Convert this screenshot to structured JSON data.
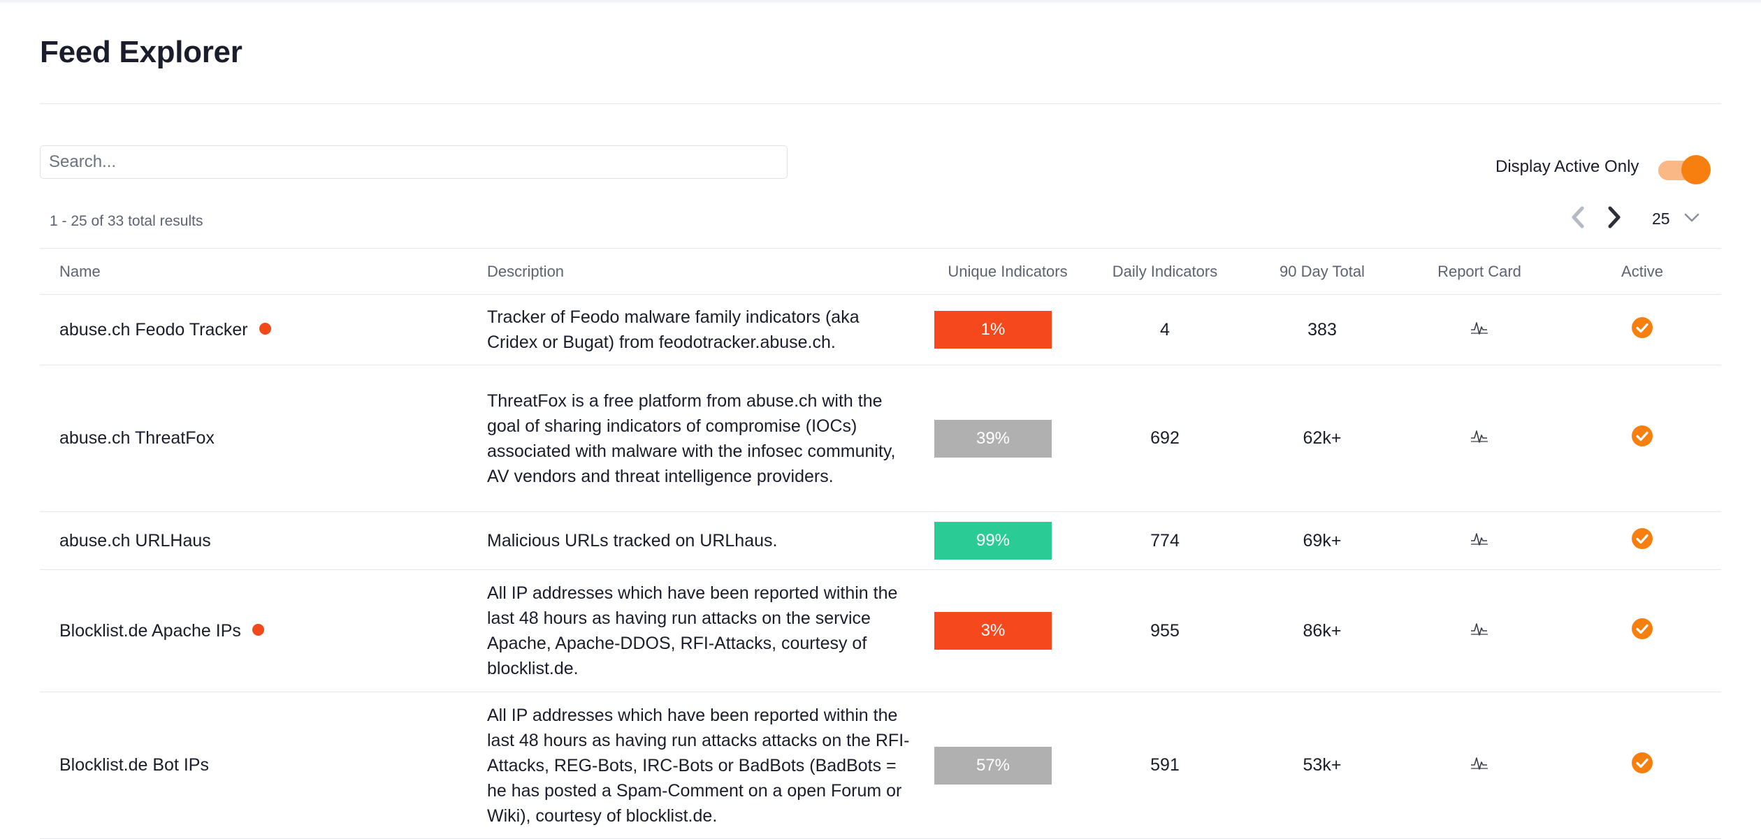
{
  "page": {
    "title": "Feed Explorer"
  },
  "search": {
    "placeholder": "Search...",
    "value": ""
  },
  "filters": {
    "active_only_label": "Display Active Only",
    "active_only": true
  },
  "pagination": {
    "summary": "1 - 25 of 33 total results",
    "per_page": "25"
  },
  "table": {
    "columns": {
      "name": "Name",
      "description": "Description",
      "unique": "Unique Indicators",
      "daily": "Daily Indicators",
      "total": "90 Day Total",
      "report": "Report Card",
      "active": "Active"
    },
    "rows": [
      {
        "name": "abuse.ch Feodo Tracker",
        "alert": true,
        "description": "Tracker of Feodo malware family indicators (aka Cridex or Bugat) from feodotracker.abuse.ch.",
        "unique_pct": "1%",
        "unique_color": "#f5481c",
        "daily": "4",
        "total": "383",
        "active": true
      },
      {
        "name": "abuse.ch ThreatFox",
        "alert": false,
        "description": "ThreatFox is a free platform from abuse.ch with the goal of sharing indicators of compromise (IOCs) associated with malware with the infosec community, AV vendors and threat intelligence providers.",
        "unique_pct": "39%",
        "unique_color": "#b0b0b0",
        "daily": "692",
        "total": "62k+",
        "active": true
      },
      {
        "name": "abuse.ch URLHaus",
        "alert": false,
        "description": "Malicious URLs tracked on URLhaus.",
        "unique_pct": "99%",
        "unique_color": "#2bcb96",
        "daily": "774",
        "total": "69k+",
        "active": true
      },
      {
        "name": "Blocklist.de Apache IPs",
        "alert": true,
        "description": "All IP addresses which have been reported within the last 48 hours as having run attacks on the service Apache, Apache-DDOS, RFI-Attacks, courtesy of blocklist.de.",
        "unique_pct": "3%",
        "unique_color": "#f5481c",
        "daily": "955",
        "total": "86k+",
        "active": true
      },
      {
        "name": "Blocklist.de Bot IPs",
        "alert": false,
        "description": "All IP addresses which have been reported within the last 48 hours as having run attacks attacks on the RFI-Attacks, REG-Bots, IRC-Bots or BadBots (BadBots = he has posted a Spam-Comment on a open Forum or Wiki), courtesy of blocklist.de.",
        "unique_pct": "57%",
        "unique_color": "#b0b0b0",
        "daily": "591",
        "total": "53k+",
        "active": true
      }
    ]
  },
  "colors": {
    "accent": "#f77f0f",
    "alert_dot": "#f2491b",
    "text": "#1a1d2b",
    "muted": "#5d6371"
  }
}
